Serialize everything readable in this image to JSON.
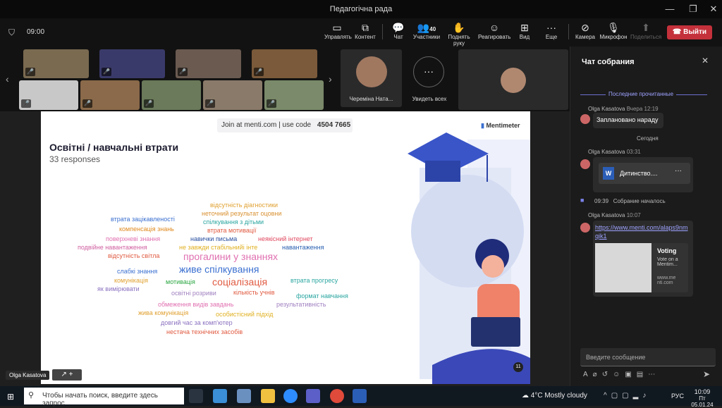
{
  "window": {
    "title": "Педагогічна рада",
    "minimize": "—",
    "maximize": "❐",
    "close": "✕"
  },
  "toolbar": {
    "timer": "09:00",
    "items": [
      {
        "label": "Управлять",
        "icon": "share-tray-icon"
      },
      {
        "label": "Контент",
        "icon": "content-icon"
      },
      {
        "label": "Чат",
        "icon": "chat-icon"
      },
      {
        "label": "Участники",
        "icon": "people-icon",
        "badge": "40"
      },
      {
        "label": "Поднять руку",
        "icon": "hand-icon"
      },
      {
        "label": "Реагировать",
        "icon": "smile-icon"
      },
      {
        "label": "Вид",
        "icon": "grid-icon"
      },
      {
        "label": "Еще",
        "icon": "more-icon"
      },
      {
        "label": "Камера",
        "icon": "camera-off-icon"
      },
      {
        "label": "Микрофон",
        "icon": "mic-icon"
      },
      {
        "label": "Поделиться",
        "icon": "share-icon"
      }
    ],
    "leave": "Выйти"
  },
  "gallery": {
    "pinned_name": "Череміна Ната...",
    "see_all": "Увидеть всех"
  },
  "slide": {
    "join_text": "Join at menti.com | use code",
    "code": "4504 7665",
    "brand": "Mentimeter",
    "title": "Освітні / навчальні втрати",
    "responses": "33 responses",
    "words": [
      {
        "text": "відсутність діагностики",
        "color": "#e0a030"
      },
      {
        "text": "неточний результат оцовни",
        "color": "#d89030"
      },
      {
        "text": "втрата зацікавленості",
        "color": "#3a6fd0"
      },
      {
        "text": "спілкування з дітьми",
        "color": "#2aa6a0"
      },
      {
        "text": "компенсація знань",
        "color": "#e08a20"
      },
      {
        "text": "втрата мотивації",
        "color": "#e05a40"
      },
      {
        "text": "поверхневі знання",
        "color": "#e070b0"
      },
      {
        "text": "навички письма",
        "color": "#2a50a0"
      },
      {
        "text": "неякісний інтернет",
        "color": "#e04a60"
      },
      {
        "text": "подвійне навантаження",
        "color": "#d060a0"
      },
      {
        "text": "не завжди стабільнийі інте",
        "color": "#e0b020"
      },
      {
        "text": "навантаження",
        "color": "#2a60b0"
      },
      {
        "text": "відсутність світла",
        "color": "#e05a40"
      },
      {
        "text": "прогалини у знаннях",
        "color": "#e070b0"
      },
      {
        "text": "живе спілкування",
        "color": "#3a6fd0"
      },
      {
        "text": "слабкі знання",
        "color": "#3a6fd0"
      },
      {
        "text": "комунікація",
        "color": "#e0a030"
      },
      {
        "text": "соціалізація",
        "color": "#e05a40"
      },
      {
        "text": "втрата прогресу",
        "color": "#2aa6a0"
      },
      {
        "text": "мотивація",
        "color": "#2aa640"
      },
      {
        "text": "як вимірювати",
        "color": "#8a70c0"
      },
      {
        "text": "освітні розриви",
        "color": "#a080c0"
      },
      {
        "text": "кількість учнів",
        "color": "#e05a40"
      },
      {
        "text": "формат навчання",
        "color": "#2aa6a0"
      },
      {
        "text": "обмеження видів завдань",
        "color": "#e070b0"
      },
      {
        "text": "результативність",
        "color": "#a080c0"
      },
      {
        "text": "жива комунікація",
        "color": "#e0a030"
      },
      {
        "text": "особистісний підхід",
        "color": "#e0b020"
      },
      {
        "text": "довгий час за комп'ютер",
        "color": "#8a70c0"
      },
      {
        "text": "нестача технічних засобів",
        "color": "#e05a40"
      }
    ],
    "counter": "11"
  },
  "presenter": {
    "name": "Olga Kasatova"
  },
  "chat": {
    "title": "Чат собрания",
    "last_read": "Последние прочитанные",
    "messages": [
      {
        "author": "Olga Kasatova",
        "time": "Вчера 12:19",
        "text": "Заплановано нараду"
      },
      {
        "divider": "Сегодня"
      },
      {
        "author": "Olga Kasatova",
        "time": "03:31",
        "file": "Дитинство...."
      },
      {
        "event_time": "09:39",
        "event": "Собрание началось"
      },
      {
        "author": "Olga Kasatova",
        "time": "10:07",
        "link": "https://www.menti.com/alaps9nmqik1",
        "card_title": "Voting",
        "card_text": "Vote on a Mentim...",
        "card_url": "www.me nti.com"
      }
    ],
    "input_placeholder": "Введите сообщение"
  },
  "taskbar": {
    "search_placeholder": "Чтобы начать поиск, введите здесь запрос",
    "weather": "4°C  Mostly cloudy",
    "lang": "РУС",
    "time": "10:09",
    "date": "Пт 05.01.24"
  }
}
